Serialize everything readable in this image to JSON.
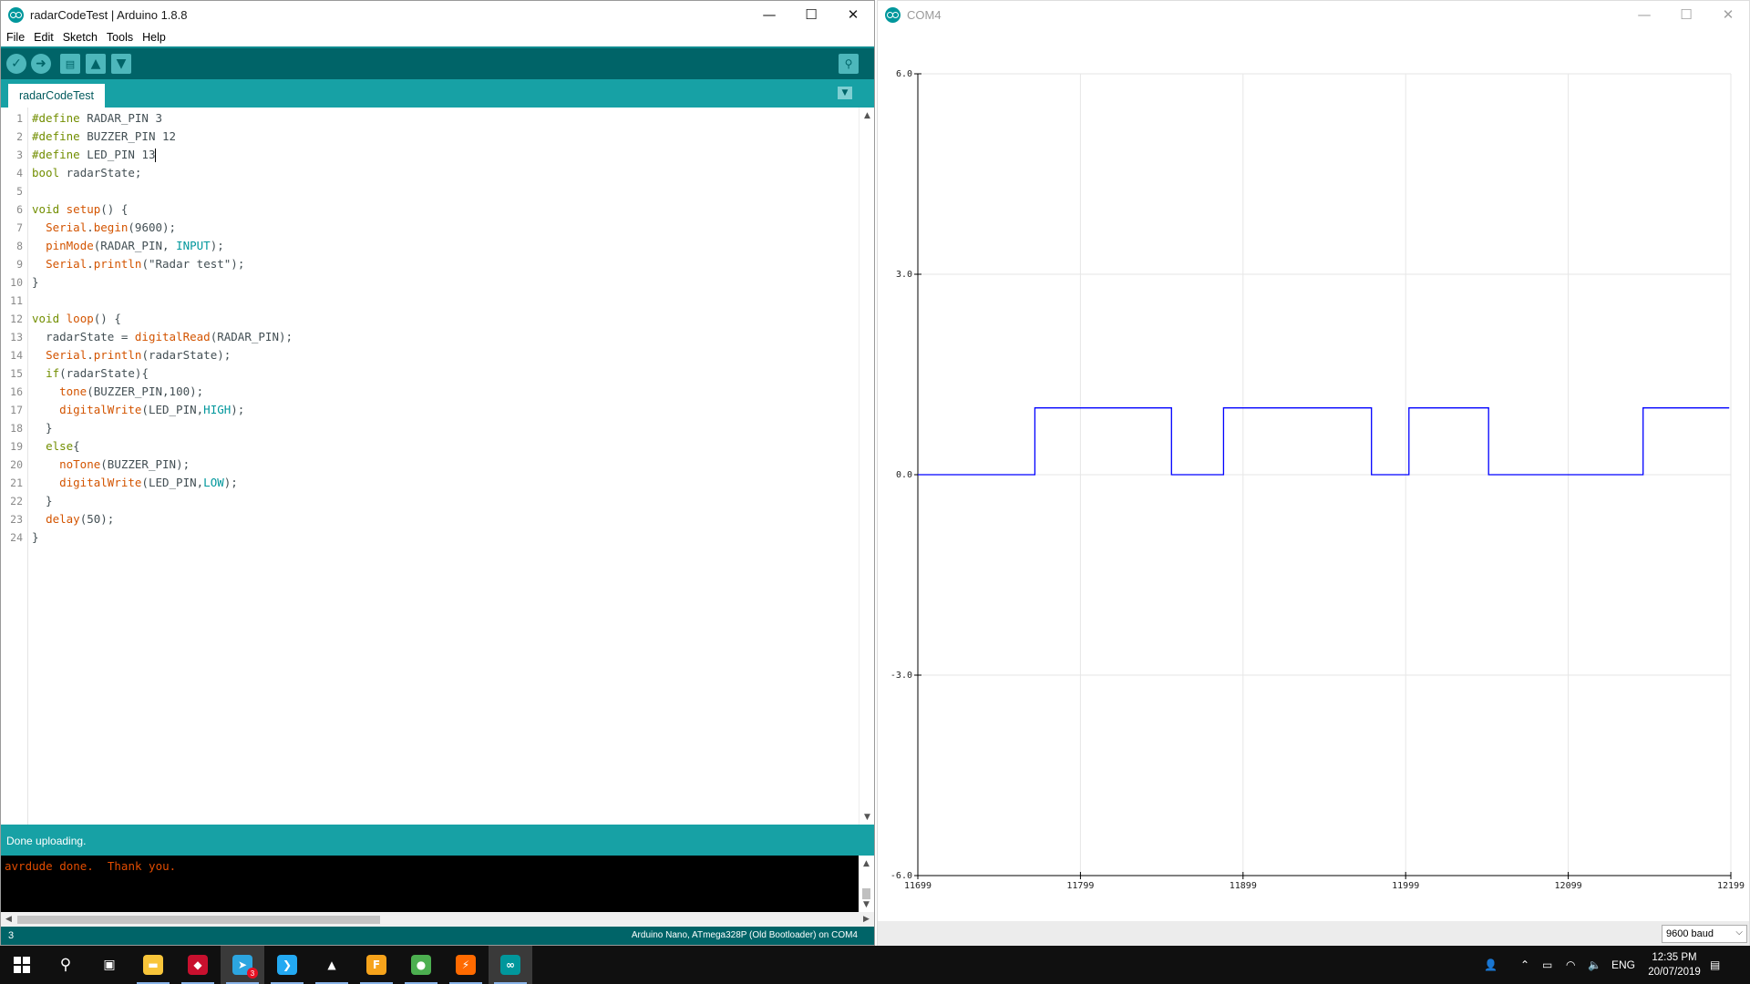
{
  "ide": {
    "title": "radarCodeTest | Arduino 1.8.8",
    "window_controls": {
      "minimize": "—",
      "maximize": "☐",
      "close": "✕"
    },
    "menu": [
      "File",
      "Edit",
      "Sketch",
      "Tools",
      "Help"
    ],
    "toolbar": {
      "verify_icon": "checkmark-icon",
      "upload_icon": "arrow-right-icon",
      "new_icon": "new-file-icon",
      "open_icon": "arrow-up-icon",
      "save_icon": "arrow-down-icon",
      "serial_monitor_icon": "magnifier-icon"
    },
    "tab_label": "radarCodeTest",
    "code_lines": [
      "#define RADAR_PIN 3",
      "#define BUZZER_PIN 12",
      "#define LED_PIN 13",
      "bool radarState;",
      "",
      "void setup() {",
      "  Serial.begin(9600);",
      "  pinMode(RADAR_PIN, INPUT);",
      "  Serial.println(\"Radar test\");",
      "}",
      "",
      "void loop() {",
      "  radarState = digitalRead(RADAR_PIN);",
      "  Serial.println(radarState);",
      "  if(radarState){",
      "    tone(BUZZER_PIN,100);",
      "    digitalWrite(LED_PIN,HIGH);",
      "  }",
      "  else{",
      "    noTone(BUZZER_PIN);",
      "    digitalWrite(LED_PIN,LOW);",
      "  }",
      "  delay(50);",
      "}"
    ],
    "status_message": "Done uploading.",
    "console_output": "avrdude done.  Thank you.",
    "cursor_line": "3",
    "board_info": "Arduino Nano, ATmega328P (Old Bootloader) on COM4"
  },
  "plotter": {
    "title": "COM4",
    "baud": "9600 baud"
  },
  "chart_data": {
    "type": "line",
    "xlim": [
      11699,
      12199
    ],
    "ylim": [
      -6.0,
      6.0
    ],
    "x_ticks": [
      "11699",
      "11799",
      "11899",
      "11999",
      "12099",
      "12199"
    ],
    "y_ticks": [
      "6.0",
      "3.0",
      "0.0",
      "-3.0",
      "-6.0"
    ],
    "grid": true,
    "series": [
      {
        "color": "#0000ff",
        "x": [
          11699,
          11771,
          11771,
          11855,
          11855,
          11887,
          11887,
          11978,
          11978,
          12001,
          12001,
          12050,
          12050,
          12145,
          12145,
          12198
        ],
        "y": [
          0,
          0,
          1,
          1,
          0,
          0,
          1,
          1,
          0,
          0,
          1,
          1,
          0,
          0,
          1,
          1
        ]
      }
    ]
  },
  "taskbar": {
    "apps": [
      {
        "name": "file-explorer-icon",
        "color": "#f8c53a",
        "glyph": "▬"
      },
      {
        "name": "app-red-icon",
        "color": "#c8102e",
        "glyph": "◆"
      },
      {
        "name": "telegram-icon",
        "color": "#2ca5e0",
        "glyph": "➤",
        "badge": "3"
      },
      {
        "name": "vscode-icon",
        "color": "#23a9f2",
        "glyph": "❯"
      },
      {
        "name": "inkscape-icon",
        "color": "#ffffff",
        "glyph": "▲"
      },
      {
        "name": "fusion-icon",
        "color": "#f6a31b",
        "glyph": "F"
      },
      {
        "name": "chrome-icon",
        "color": "#4caf50",
        "glyph": "●"
      },
      {
        "name": "slicer-icon",
        "color": "#ff6a00",
        "glyph": "⚡"
      },
      {
        "name": "arduino-icon",
        "color": "#00979c",
        "glyph": "∞"
      }
    ],
    "language": "ENG",
    "time": "12:35 PM",
    "date": "20/07/2019"
  }
}
